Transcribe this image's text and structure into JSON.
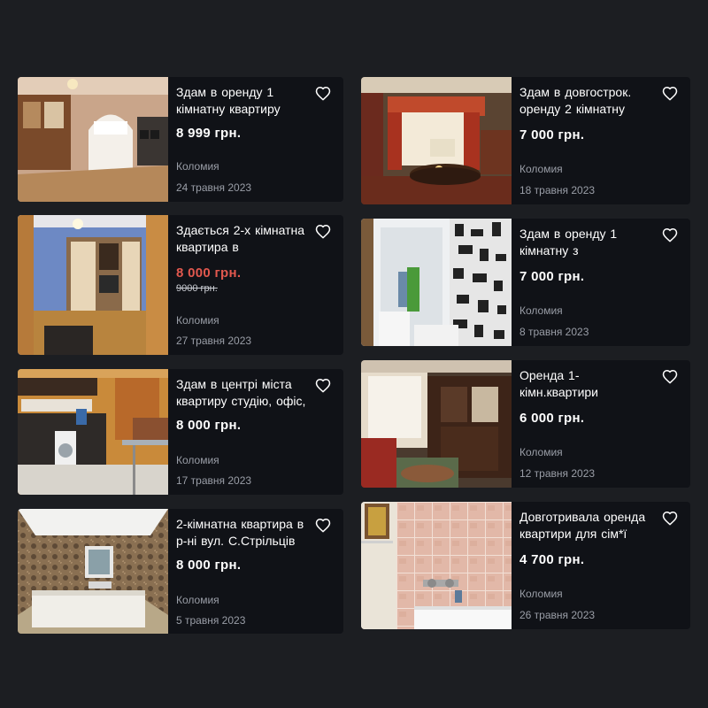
{
  "colors": {
    "background": "#1c1e22",
    "card": "#101217",
    "price_sale": "#e2584e",
    "muted": "#9a9ea7"
  },
  "listings": [
    {
      "title": "Здам в оренду 1 кімнатну квартиру",
      "price": "8 999 грн.",
      "old_price": "",
      "city": "Коломия",
      "date": "24 травня 2023",
      "photo": "room-with-balcony"
    },
    {
      "title": "Здам в довгострок. оренду 2 кімнатну",
      "price": "7 000 грн.",
      "old_price": "",
      "city": "Коломия",
      "date": "18 травня 2023",
      "photo": "living-room-curtains"
    },
    {
      "title": "Здається 2-х кімнатна квартира  в",
      "price": "8 000 грн.",
      "old_price": "9000 грн.",
      "city": "Коломия",
      "date": "27 травня 2023",
      "photo": "room-wardrobe"
    },
    {
      "title": "Здам в оренду 1 кімнатну з",
      "price": "7 000 грн.",
      "old_price": "",
      "city": "Коломия",
      "date": "8 травня 2023",
      "photo": "bathroom-curtain"
    },
    {
      "title": "Здам в центрі міста квартиру студію, офіс,",
      "price": "8 000 грн.",
      "old_price": "",
      "city": "Коломия",
      "date": "17 травня 2023",
      "photo": "studio-kitchen"
    },
    {
      "title": "Оренда 1-кімн.квартири",
      "price": "6 000 грн.",
      "old_price": "",
      "city": "Коломия",
      "date": "12 травня 2023",
      "photo": "room-window-cabinet"
    },
    {
      "title": "2-кімнатна квартира в р-ні вул. С.Стрільців",
      "price": "8 000 грн.",
      "old_price": "",
      "city": "Коломия",
      "date": "5 травня 2023",
      "photo": "bedroom-mattress"
    },
    {
      "title": "Довготривала  оренда квартири для сім*ї",
      "price": "4 700 грн.",
      "old_price": "",
      "city": "Коломия",
      "date": "26 травня 2023",
      "photo": "tiled-bathroom"
    }
  ]
}
